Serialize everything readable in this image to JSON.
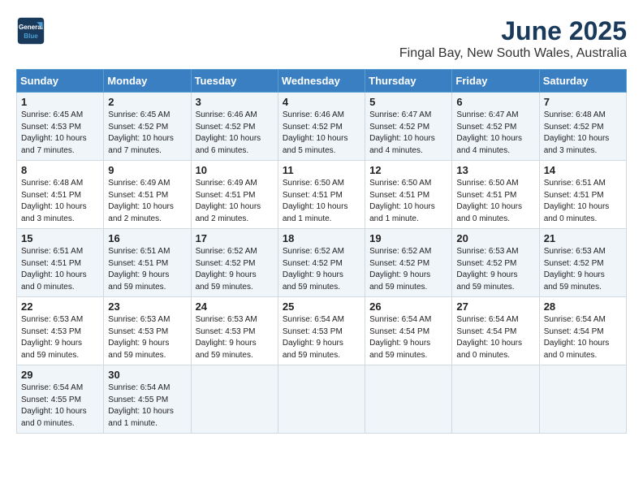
{
  "logo": {
    "line1": "General",
    "line2": "Blue"
  },
  "title": "June 2025",
  "location": "Fingal Bay, New South Wales, Australia",
  "days_header": [
    "Sunday",
    "Monday",
    "Tuesday",
    "Wednesday",
    "Thursday",
    "Friday",
    "Saturday"
  ],
  "weeks": [
    [
      {
        "num": "1",
        "info": "Sunrise: 6:45 AM\nSunset: 4:53 PM\nDaylight: 10 hours\nand 7 minutes."
      },
      {
        "num": "2",
        "info": "Sunrise: 6:45 AM\nSunset: 4:52 PM\nDaylight: 10 hours\nand 7 minutes."
      },
      {
        "num": "3",
        "info": "Sunrise: 6:46 AM\nSunset: 4:52 PM\nDaylight: 10 hours\nand 6 minutes."
      },
      {
        "num": "4",
        "info": "Sunrise: 6:46 AM\nSunset: 4:52 PM\nDaylight: 10 hours\nand 5 minutes."
      },
      {
        "num": "5",
        "info": "Sunrise: 6:47 AM\nSunset: 4:52 PM\nDaylight: 10 hours\nand 4 minutes."
      },
      {
        "num": "6",
        "info": "Sunrise: 6:47 AM\nSunset: 4:52 PM\nDaylight: 10 hours\nand 4 minutes."
      },
      {
        "num": "7",
        "info": "Sunrise: 6:48 AM\nSunset: 4:52 PM\nDaylight: 10 hours\nand 3 minutes."
      }
    ],
    [
      {
        "num": "8",
        "info": "Sunrise: 6:48 AM\nSunset: 4:51 PM\nDaylight: 10 hours\nand 3 minutes."
      },
      {
        "num": "9",
        "info": "Sunrise: 6:49 AM\nSunset: 4:51 PM\nDaylight: 10 hours\nand 2 minutes."
      },
      {
        "num": "10",
        "info": "Sunrise: 6:49 AM\nSunset: 4:51 PM\nDaylight: 10 hours\nand 2 minutes."
      },
      {
        "num": "11",
        "info": "Sunrise: 6:50 AM\nSunset: 4:51 PM\nDaylight: 10 hours\nand 1 minute."
      },
      {
        "num": "12",
        "info": "Sunrise: 6:50 AM\nSunset: 4:51 PM\nDaylight: 10 hours\nand 1 minute."
      },
      {
        "num": "13",
        "info": "Sunrise: 6:50 AM\nSunset: 4:51 PM\nDaylight: 10 hours\nand 0 minutes."
      },
      {
        "num": "14",
        "info": "Sunrise: 6:51 AM\nSunset: 4:51 PM\nDaylight: 10 hours\nand 0 minutes."
      }
    ],
    [
      {
        "num": "15",
        "info": "Sunrise: 6:51 AM\nSunset: 4:51 PM\nDaylight: 10 hours\nand 0 minutes."
      },
      {
        "num": "16",
        "info": "Sunrise: 6:51 AM\nSunset: 4:51 PM\nDaylight: 9 hours\nand 59 minutes."
      },
      {
        "num": "17",
        "info": "Sunrise: 6:52 AM\nSunset: 4:52 PM\nDaylight: 9 hours\nand 59 minutes."
      },
      {
        "num": "18",
        "info": "Sunrise: 6:52 AM\nSunset: 4:52 PM\nDaylight: 9 hours\nand 59 minutes."
      },
      {
        "num": "19",
        "info": "Sunrise: 6:52 AM\nSunset: 4:52 PM\nDaylight: 9 hours\nand 59 minutes."
      },
      {
        "num": "20",
        "info": "Sunrise: 6:53 AM\nSunset: 4:52 PM\nDaylight: 9 hours\nand 59 minutes."
      },
      {
        "num": "21",
        "info": "Sunrise: 6:53 AM\nSunset: 4:52 PM\nDaylight: 9 hours\nand 59 minutes."
      }
    ],
    [
      {
        "num": "22",
        "info": "Sunrise: 6:53 AM\nSunset: 4:53 PM\nDaylight: 9 hours\nand 59 minutes."
      },
      {
        "num": "23",
        "info": "Sunrise: 6:53 AM\nSunset: 4:53 PM\nDaylight: 9 hours\nand 59 minutes."
      },
      {
        "num": "24",
        "info": "Sunrise: 6:53 AM\nSunset: 4:53 PM\nDaylight: 9 hours\nand 59 minutes."
      },
      {
        "num": "25",
        "info": "Sunrise: 6:54 AM\nSunset: 4:53 PM\nDaylight: 9 hours\nand 59 minutes."
      },
      {
        "num": "26",
        "info": "Sunrise: 6:54 AM\nSunset: 4:54 PM\nDaylight: 9 hours\nand 59 minutes."
      },
      {
        "num": "27",
        "info": "Sunrise: 6:54 AM\nSunset: 4:54 PM\nDaylight: 10 hours\nand 0 minutes."
      },
      {
        "num": "28",
        "info": "Sunrise: 6:54 AM\nSunset: 4:54 PM\nDaylight: 10 hours\nand 0 minutes."
      }
    ],
    [
      {
        "num": "29",
        "info": "Sunrise: 6:54 AM\nSunset: 4:55 PM\nDaylight: 10 hours\nand 0 minutes."
      },
      {
        "num": "30",
        "info": "Sunrise: 6:54 AM\nSunset: 4:55 PM\nDaylight: 10 hours\nand 1 minute."
      },
      {
        "num": "",
        "info": ""
      },
      {
        "num": "",
        "info": ""
      },
      {
        "num": "",
        "info": ""
      },
      {
        "num": "",
        "info": ""
      },
      {
        "num": "",
        "info": ""
      }
    ]
  ]
}
